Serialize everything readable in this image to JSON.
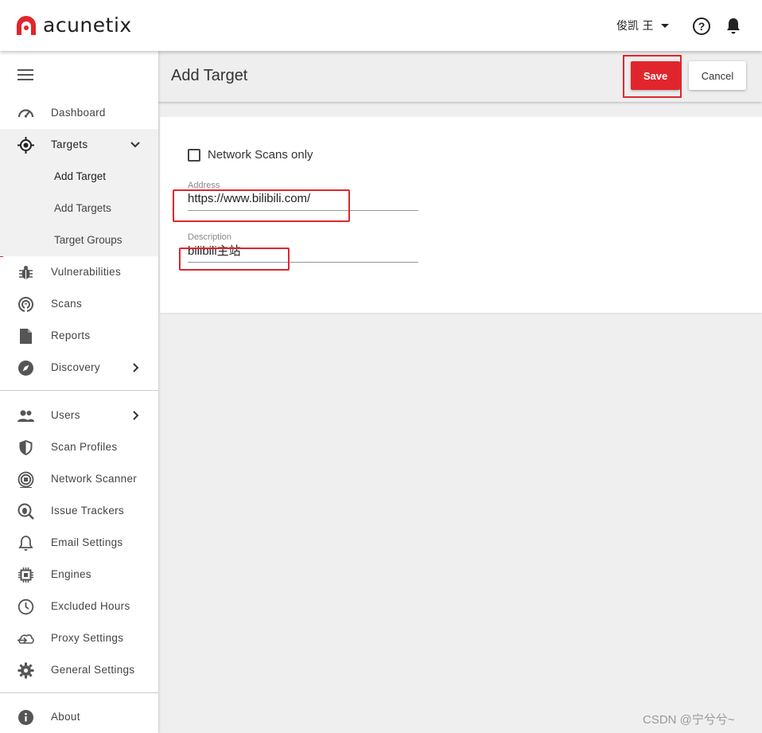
{
  "app": {
    "brand": "acunetix",
    "brand_color": "#e0262c"
  },
  "topbar": {
    "user_name": "俊凯 王",
    "help_icon": "help-icon",
    "bell_icon": "bell-icon"
  },
  "sidebar": {
    "items": [
      {
        "label": "Dashboard",
        "icon": "dashboard-icon"
      },
      {
        "label": "Targets",
        "icon": "target-icon",
        "expanded": true
      },
      {
        "label": "Vulnerabilities",
        "icon": "bug-icon"
      },
      {
        "label": "Scans",
        "icon": "scan-icon"
      },
      {
        "label": "Reports",
        "icon": "report-icon"
      },
      {
        "label": "Discovery",
        "icon": "compass-icon"
      },
      {
        "label": "Users",
        "icon": "users-icon"
      },
      {
        "label": "Scan Profiles",
        "icon": "shield-icon"
      },
      {
        "label": "Network Scanner",
        "icon": "network-scanner-icon"
      },
      {
        "label": "Issue Trackers",
        "icon": "issue-tracker-icon"
      },
      {
        "label": "Email Settings",
        "icon": "bell-outline-icon"
      },
      {
        "label": "Engines",
        "icon": "chip-icon"
      },
      {
        "label": "Excluded Hours",
        "icon": "clock-icon"
      },
      {
        "label": "Proxy Settings",
        "icon": "cloud-upload-icon"
      },
      {
        "label": "General Settings",
        "icon": "gear-icon"
      },
      {
        "label": "About",
        "icon": "info-icon"
      }
    ],
    "sub_items": [
      {
        "label": "Add Target",
        "current": true
      },
      {
        "label": "Add Targets"
      },
      {
        "label": "Target Groups"
      }
    ]
  },
  "main": {
    "title": "Add Target",
    "save_label": "Save",
    "cancel_label": "Cancel",
    "network_scans_label": "Network Scans only",
    "network_scans_checked": false,
    "address_label": "Address",
    "address_value": "https://www.bilibili.com/",
    "description_label": "Description",
    "description_value": "bilibili主站"
  },
  "watermark": "CSDN @宁兮兮~"
}
